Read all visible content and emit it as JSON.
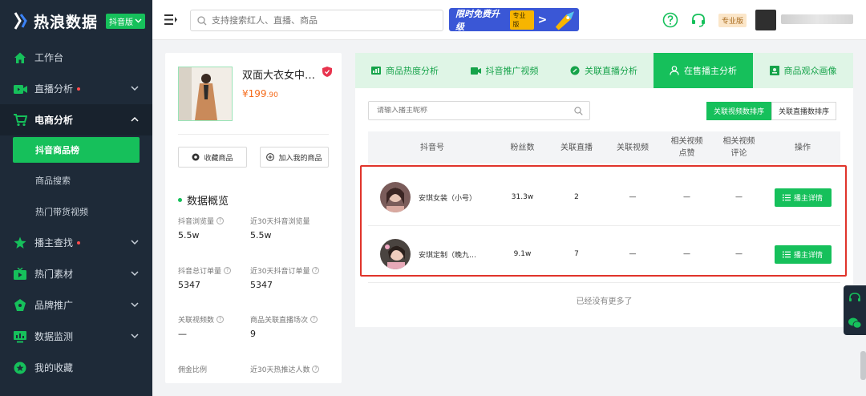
{
  "app": {
    "logo_text": "热浪数据",
    "version_badge": "抖音版"
  },
  "sidebar": {
    "items": [
      {
        "label": "工作台",
        "icon": "home-icon"
      },
      {
        "label": "直播分析",
        "icon": "live-icon",
        "dot": true
      },
      {
        "label": "电商分析",
        "icon": "cart-icon",
        "open": true
      },
      {
        "label": "播主查找",
        "icon": "star-icon",
        "dot": true
      },
      {
        "label": "热门素材",
        "icon": "tv-icon"
      },
      {
        "label": "品牌推广",
        "icon": "diamond-icon"
      },
      {
        "label": "数据监测",
        "icon": "monitor-icon"
      },
      {
        "label": "我的收藏",
        "icon": "favorite-icon"
      }
    ],
    "sub_items": [
      "抖音商品榜",
      "商品搜索",
      "热门带货视频"
    ]
  },
  "topbar": {
    "search_placeholder": "支持搜索红人、直播、商品",
    "promo_text": "限时免费升级",
    "promo_badge": "专业版",
    "pro_badge": "专业版"
  },
  "product": {
    "title": "双面大衣女中长款",
    "price_main": "¥199",
    "price_decimal": ".90",
    "favorite_label": "收藏商品",
    "add_label": "加入我的商品",
    "overview_title": "数据概览",
    "stats": [
      {
        "label": "抖音浏览量",
        "value": "5.5w"
      },
      {
        "label": "近30天抖音浏览量",
        "value": "5.5w"
      },
      {
        "label": "抖音总订单量",
        "value": "5347"
      },
      {
        "label": "近30天抖音订单量",
        "value": "5347"
      },
      {
        "label": "关联视频数",
        "value": "—"
      },
      {
        "label": "商品关联直播场次",
        "value": "9"
      },
      {
        "label": "佣金比例",
        "value": ""
      },
      {
        "label": "近30天热推达人数",
        "value": ""
      }
    ]
  },
  "main": {
    "tabs": [
      {
        "label": "商品热度分析",
        "icon": "chart-icon"
      },
      {
        "label": "抖音推广视频",
        "icon": "video-icon"
      },
      {
        "label": "关联直播分析",
        "icon": "link-icon"
      },
      {
        "label": "在售播主分析",
        "icon": "user-icon",
        "active": true
      },
      {
        "label": "商品观众画像",
        "icon": "portrait-icon"
      }
    ],
    "filter_placeholder": "请输入播主昵称",
    "sort_buttons": [
      "关联视频数排序",
      "关联直播数排序"
    ],
    "columns": [
      "抖音号",
      "粉丝数",
      "关联直播",
      "关联视频",
      "相关视频\n点赞",
      "相关视频\n评论",
      "操作"
    ],
    "rows": [
      {
        "name": "安琪女装（小号）",
        "fans": "31.3w",
        "live": "2",
        "video": "—",
        "likes": "—",
        "comments": "—",
        "action": "播主详情"
      },
      {
        "name": "安琪定制（晚九点）",
        "fans": "9.1w",
        "live": "7",
        "video": "—",
        "likes": "—",
        "comments": "—",
        "action": "播主详情"
      }
    ],
    "end_text": "已经没有更多了"
  },
  "colors": {
    "accent": "#16c05b",
    "sidebar_bg": "#1e2a38",
    "price": "#f56b1b",
    "highlight": "#e0342b"
  }
}
